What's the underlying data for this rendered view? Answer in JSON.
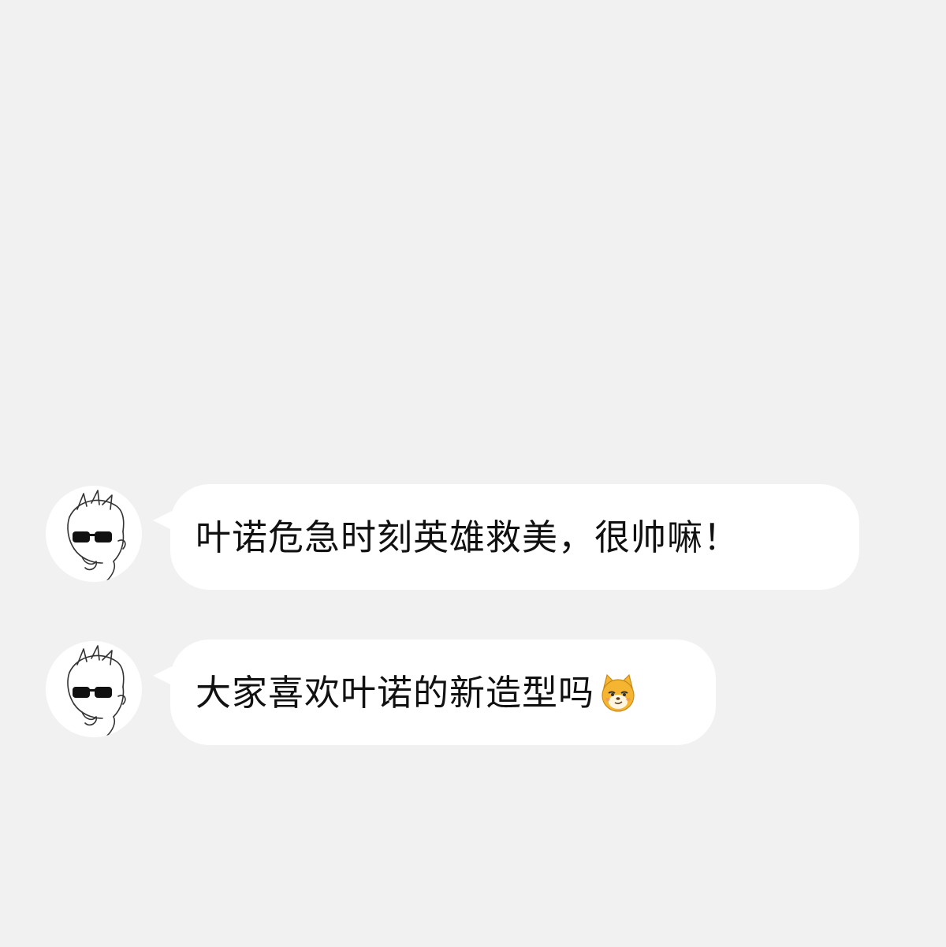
{
  "chat": {
    "messages": [
      {
        "sender_avatar": "sunglasses-boy-avatar",
        "text": "叶诺危急时刻英雄救美，很帅嘛！",
        "emoji": null
      },
      {
        "sender_avatar": "sunglasses-boy-avatar",
        "text": "大家喜欢叶诺的新造型吗",
        "emoji": "smirking-dog-sticker"
      }
    ]
  },
  "colors": {
    "background": "#f1f1f1",
    "bubble": "#ffffff",
    "text": "#111111",
    "sticker_fill": "#f5b531"
  }
}
